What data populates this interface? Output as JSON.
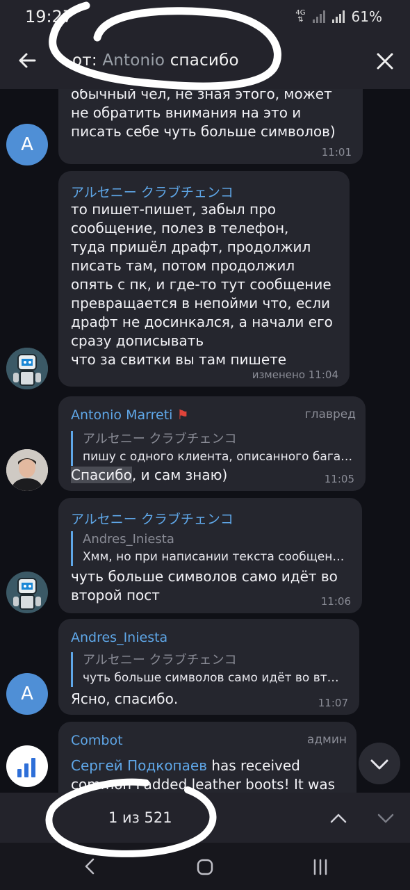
{
  "status_bar": {
    "time": "19:27",
    "network": "4G",
    "battery": "61%"
  },
  "toolbar": {
    "query_prefix": "от: ",
    "query_user": "Antonio",
    "query_text": " спасибо"
  },
  "messages": [
    {
      "avatar": "A",
      "text": "обычный чел, не зная этого, может\nне обратить внимания на это и\nписать себе чуть больше символов)",
      "time": "11:01"
    },
    {
      "name": "アルセニー クラブチェンコ",
      "text": "то пишет-пишет, забыл про\nсообщение, полез в телефон,\nтуда пришёл драфт, продолжил\nписать там, потом продолжил\nопять с пк, и где-то тут сообщение\nпревращается в непойми что, если\nдрафт не досинкался, а начали его\nсразу дописывать\nчто за свитки вы там пишете",
      "time": "изменено 11:04"
    },
    {
      "name": "Antonio Marreti",
      "role": "главред",
      "quote_name": "アルセニー クラブチェンコ",
      "quote_text": "пишу с одного клиента, описанного бага…",
      "text_highlight": "Спасибо",
      "text_rest": ", и сам знаю)",
      "time": "11:05"
    },
    {
      "name": "アルセニー クラブチェンコ",
      "quote_name": "Andres_Iniesta",
      "quote_text": "Хмм, но при написании текста сообщен…",
      "text": "чуть больше символов само идёт во\nвторой пост",
      "time": "11:06"
    },
    {
      "avatar": "A",
      "name": "Andres_Iniesta",
      "quote_name": "アルセニー クラブチェンコ",
      "quote_text": "чуть больше символов само идёт во вт…",
      "text": "Ясно, спасибо.",
      "time": "11:07"
    },
    {
      "name": "Combot",
      "role": "админ",
      "text_link": "Сергей Подкопаев",
      "text_rest": " has received\ncommon Padded leather boots! It was"
    }
  ],
  "search": {
    "counter": "1 из 521"
  },
  "icons": [
    "back-arrow-icon",
    "close-icon",
    "chevron-up-icon",
    "chevron-down-icon",
    "scroll-down-icon",
    "nav-back-icon",
    "nav-home-icon",
    "nav-recents-icon"
  ],
  "colors": {
    "accent": "#5fa7e8",
    "bubble": "#25262e",
    "background": "#0f1016"
  }
}
